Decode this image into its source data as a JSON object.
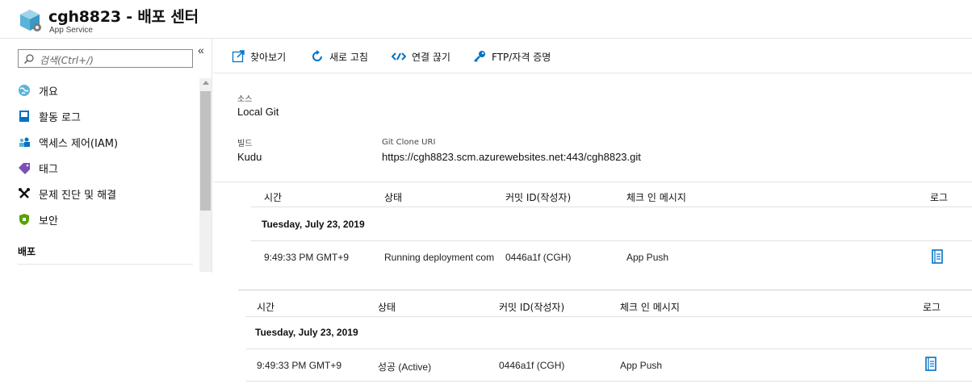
{
  "header": {
    "title": "cgh8823 - 배포 센터",
    "subtitle": "App Service"
  },
  "sidebar": {
    "search_placeholder": "검색(Ctrl+/)",
    "collapse_label": "«",
    "items": [
      {
        "label": "개요",
        "icon": "globe-icon"
      },
      {
        "label": "활동 로그",
        "icon": "activity-log-icon"
      },
      {
        "label": "액세스 제어(IAM)",
        "icon": "users-icon"
      },
      {
        "label": "태그",
        "icon": "tag-icon"
      },
      {
        "label": "문제 진단 및 해결",
        "icon": "wrench-icon"
      },
      {
        "label": "보안",
        "icon": "shield-icon"
      }
    ],
    "section_label": "배포"
  },
  "toolbar": {
    "browse": "찾아보기",
    "refresh": "새로 고침",
    "disconnect": "연결 끊기",
    "ftp": "FTP/자격 증명"
  },
  "info": {
    "source_label": "소스",
    "source_value": "Local Git",
    "build_label": "빌드",
    "build_value": "Kudu",
    "git_uri_label": "Git Clone URI",
    "git_uri_value": "https://cgh8823.scm.azurewebsites.net:443/cgh8823.git"
  },
  "tables": [
    {
      "headers": {
        "time": "시간",
        "status": "상태",
        "commit": "커밋 ID(작성자)",
        "message": "체크 인 메시지",
        "log": "로그"
      },
      "date": "Tuesday, July 23, 2019",
      "row": {
        "time": "9:49:33 PM GMT+9",
        "status": "Running deployment com",
        "commit": "0446a1f (CGH)",
        "message": "App Push"
      }
    },
    {
      "headers": {
        "time": "시간",
        "status": "상태",
        "commit": "커밋 ID(작성자)",
        "message": "체크 인 메시지",
        "log": "로그"
      },
      "date": "Tuesday, July 23, 2019",
      "row": {
        "time": "9:49:33 PM GMT+9",
        "status": "성공 (Active)",
        "commit": "0446a1f (CGH)",
        "message": "App Push"
      }
    }
  ],
  "colors": {
    "accent": "#0078d4",
    "nav_blue": "#0072c6",
    "tag_purple": "#7a4fb6",
    "shield_green": "#57a300"
  }
}
